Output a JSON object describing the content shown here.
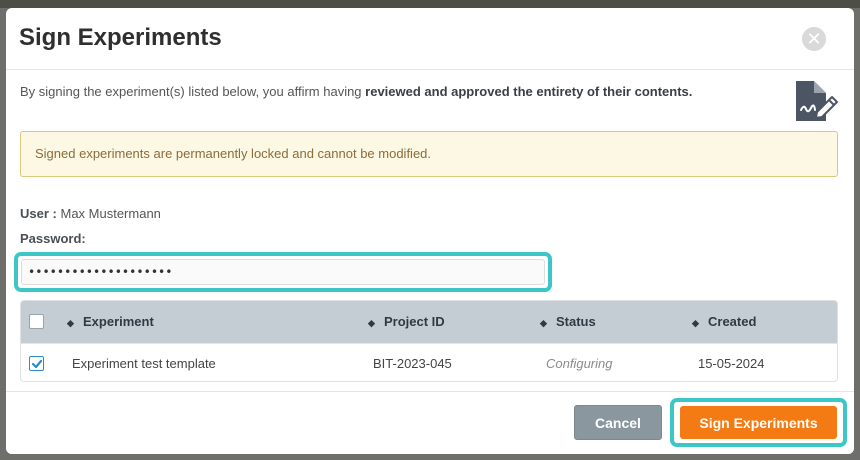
{
  "modal": {
    "title": "Sign Experiments",
    "close_icon": "close-icon",
    "intro_prefix": "By signing the experiment(s) listed below, you affirm having ",
    "intro_emphasis": "reviewed and approved the entirety of their contents.",
    "sign_icon": "signature-document-icon"
  },
  "warning": {
    "text": "Signed experiments are permanently locked and cannot be modified."
  },
  "user": {
    "label": "User :",
    "name": "Max Mustermann"
  },
  "password": {
    "label": "Password:",
    "value": "••••••••••••••••••••"
  },
  "table": {
    "columns": [
      {
        "label": "Experiment"
      },
      {
        "label": "Project ID"
      },
      {
        "label": "Status"
      },
      {
        "label": "Created"
      }
    ],
    "rows": [
      {
        "checked": true,
        "experiment": "Experiment test template",
        "project_id": "BIT-2023-045",
        "status": "Configuring",
        "created": "15-05-2024"
      }
    ]
  },
  "footer": {
    "cancel_label": "Cancel",
    "sign_label": "Sign Experiments"
  },
  "colors": {
    "accent_orange": "#f47b14",
    "focus_teal": "#3cc6c6",
    "cancel_gray": "#8b979e",
    "warning_bg": "#fcf8e3",
    "warning_text": "#8a6d3b",
    "header_bg": "#c4cdd3",
    "checkbox_blue": "#2a8ec6"
  }
}
